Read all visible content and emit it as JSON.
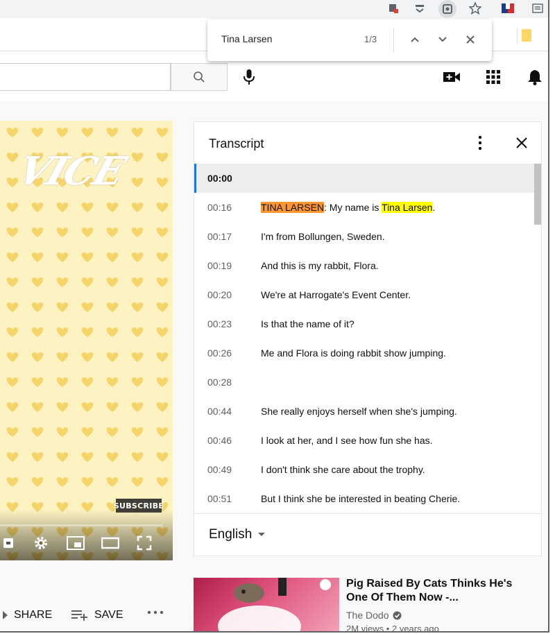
{
  "find_bar": {
    "query": "Tina Larsen",
    "match_count": "1/3"
  },
  "transcript": {
    "title": "Transcript",
    "language": "English",
    "segments": [
      {
        "time": "00:00",
        "text": "",
        "active": true
      },
      {
        "time": "00:16",
        "speaker": "TINA LARSEN",
        "text_before": ": My name is ",
        "highlight": "Tina Larsen",
        "text_after": "."
      },
      {
        "time": "00:17",
        "text": "I'm from Bollungen, Sweden."
      },
      {
        "time": "00:19",
        "text": "And this is my rabbit, Flora."
      },
      {
        "time": "00:20",
        "text": "We're at Harrogate's Event Center."
      },
      {
        "time": "00:23",
        "text": "Is that the name of it?"
      },
      {
        "time": "00:26",
        "text": "Me and Flora is doing rabbit show jumping."
      },
      {
        "time": "00:28",
        "text": ""
      },
      {
        "time": "00:44",
        "text": "She really enjoys herself when she's jumping."
      },
      {
        "time": "00:46",
        "text": "I look at her, and I see how fun she has."
      },
      {
        "time": "00:49",
        "text": "I don't think she care about the trophy."
      },
      {
        "time": "00:51",
        "text": "But I think she be interested in beating Cherie."
      }
    ]
  },
  "video": {
    "logo": "VICE",
    "subscribe_label": "SUBSCRIBE",
    "actions": {
      "share_label": "SHARE",
      "save_label": "SAVE"
    }
  },
  "recommended": {
    "title": "Pig Raised By Cats Thinks He's One Of Them Now -...",
    "channel": "The Dodo",
    "meta": "2M views • 2 years ago"
  },
  "colors": {
    "highlight_active": "#ff9632",
    "highlight_match": "#ffff00",
    "active_segment_bar": "#1a73e8"
  }
}
